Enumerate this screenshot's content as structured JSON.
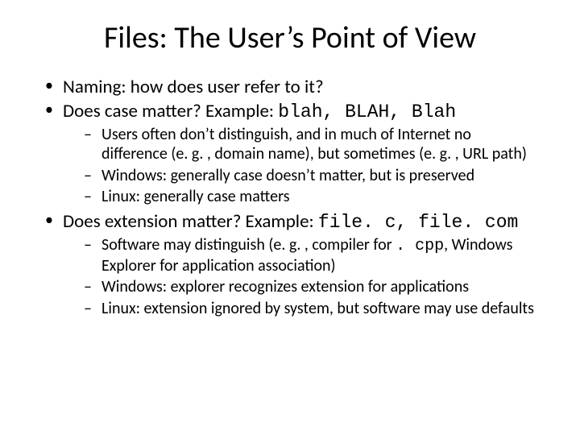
{
  "title": "Files: The User’s Point of View",
  "bullets": {
    "b1": "Naming: how does user refer to it?",
    "b2_pre": "Does case matter? Example: ",
    "b2_mono": "blah, BLAH, Blah",
    "b2_subs": {
      "s1": "Users often don’t distinguish, and in much of Internet no difference (e. g. , domain name), but sometimes (e. g. , URL path)",
      "s2": "Windows: generally case doesn’t matter, but is preserved",
      "s3": "Linux: generally case matters"
    },
    "b3_pre": "Does extension matter? Example: ",
    "b3_mono": "file. c, file. com",
    "b3_subs": {
      "s1a": "Software may distinguish (e. g. , compiler for ",
      "s1b_mono": ". cpp",
      "s1c": ", Windows Explorer for application association)",
      "s2": "Windows: explorer recognizes extension for applications",
      "s3": "Linux: extension ignored by system, but software may use defaults"
    }
  }
}
